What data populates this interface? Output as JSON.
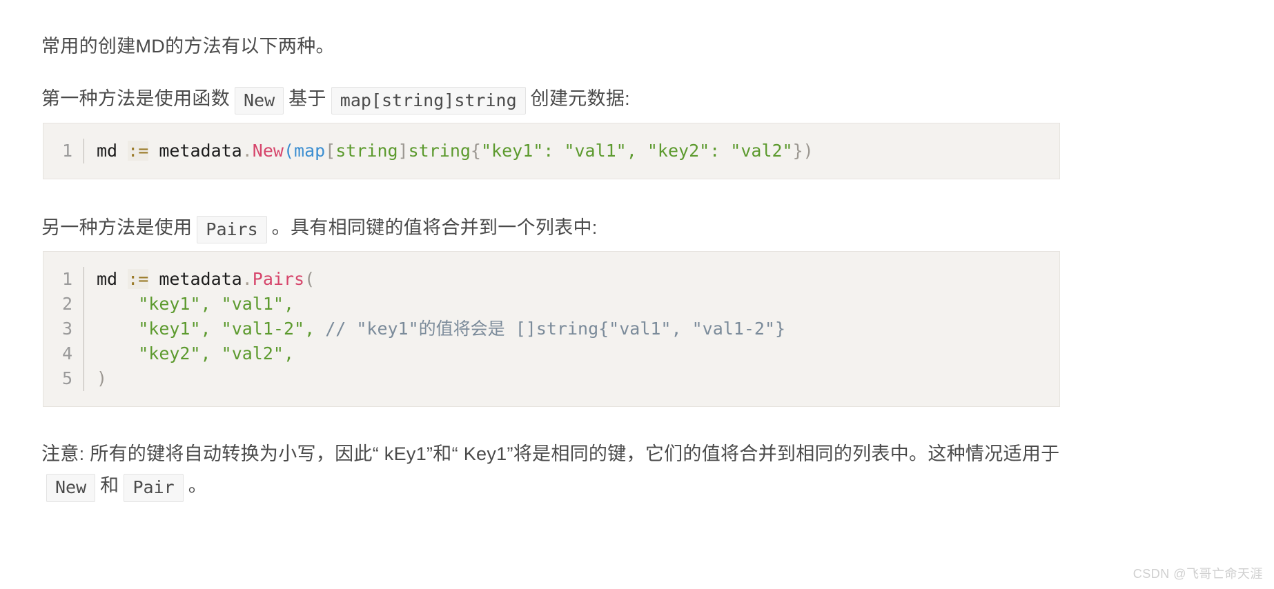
{
  "document": {
    "intro": "常用的创建MD的方法有以下两种。",
    "paragraph_first_method": {
      "part1": "第一种方法是使用函数",
      "code1": "New",
      "part2": "基于",
      "code2": "map[string]string",
      "part3": "创建元数据:"
    },
    "paragraph_second_method": {
      "part1": "另一种方法是使用",
      "code1": "Pairs",
      "part2": "。具有相同键的值将合并到一个列表中:"
    },
    "paragraph_note": {
      "part1": "注意: 所有的键将自动转换为小写，因此“ kEy1”和“ Key1”将是相同的键，它们的值将合并到相同的列表中。这种情况适用于",
      "code1": "New",
      "part2": "和",
      "code2": "Pair",
      "part3": "。"
    }
  },
  "code_block_1": {
    "language": "go",
    "lines": [
      {
        "number": "1",
        "tokens": [
          {
            "text": "md ",
            "type": "plain"
          },
          {
            "text": ":=",
            "type": "op"
          },
          {
            "text": " metadata",
            "type": "plain"
          },
          {
            "text": ".",
            "type": "dot"
          },
          {
            "text": "New",
            "type": "fn"
          },
          {
            "text": "(",
            "type": "kw"
          },
          {
            "text": "map",
            "type": "kw"
          },
          {
            "text": "[",
            "type": "punct"
          },
          {
            "text": "string",
            "type": "str"
          },
          {
            "text": "]",
            "type": "punct"
          },
          {
            "text": "string",
            "type": "str"
          },
          {
            "text": "{",
            "type": "punct"
          },
          {
            "text": "\"key1\"",
            "type": "str"
          },
          {
            "text": ":",
            "type": "str"
          },
          {
            "text": " ",
            "type": "plain"
          },
          {
            "text": "\"val1\"",
            "type": "str"
          },
          {
            "text": ",",
            "type": "str"
          },
          {
            "text": " ",
            "type": "plain"
          },
          {
            "text": "\"key2\"",
            "type": "str"
          },
          {
            "text": ":",
            "type": "str"
          },
          {
            "text": " ",
            "type": "plain"
          },
          {
            "text": "\"val2\"",
            "type": "str"
          },
          {
            "text": "}",
            "type": "punct"
          },
          {
            "text": ")",
            "type": "punct"
          }
        ]
      }
    ]
  },
  "code_block_2": {
    "language": "go",
    "lines": [
      {
        "number": "1",
        "tokens": [
          {
            "text": "md ",
            "type": "plain"
          },
          {
            "text": ":=",
            "type": "op"
          },
          {
            "text": " metadata",
            "type": "plain"
          },
          {
            "text": ".",
            "type": "dot"
          },
          {
            "text": "Pairs",
            "type": "fn"
          },
          {
            "text": "(",
            "type": "punct"
          }
        ]
      },
      {
        "number": "2",
        "tokens": [
          {
            "text": "    ",
            "type": "plain"
          },
          {
            "text": "\"key1\"",
            "type": "str"
          },
          {
            "text": ",",
            "type": "str"
          },
          {
            "text": " ",
            "type": "plain"
          },
          {
            "text": "\"val1\"",
            "type": "str"
          },
          {
            "text": ",",
            "type": "str"
          }
        ]
      },
      {
        "number": "3",
        "tokens": [
          {
            "text": "    ",
            "type": "plain"
          },
          {
            "text": "\"key1\"",
            "type": "str"
          },
          {
            "text": ",",
            "type": "str"
          },
          {
            "text": " ",
            "type": "plain"
          },
          {
            "text": "\"val1-2\"",
            "type": "str"
          },
          {
            "text": ",",
            "type": "str"
          },
          {
            "text": " ",
            "type": "plain"
          },
          {
            "text": "// \"key1\"的值将会是 []string{\"val1\", \"val1-2\"}",
            "type": "comment"
          }
        ]
      },
      {
        "number": "4",
        "tokens": [
          {
            "text": "    ",
            "type": "plain"
          },
          {
            "text": "\"key2\"",
            "type": "str"
          },
          {
            "text": ",",
            "type": "str"
          },
          {
            "text": " ",
            "type": "plain"
          },
          {
            "text": "\"val2\"",
            "type": "str"
          },
          {
            "text": ",",
            "type": "str"
          }
        ]
      },
      {
        "number": "5",
        "tokens": [
          {
            "text": ")",
            "type": "punct"
          }
        ]
      }
    ]
  },
  "watermark": {
    "text": "CSDN @飞哥亡命天涯"
  },
  "colors": {
    "page_background": "#ffffff",
    "body_text": "#4a4a4a",
    "code_background": "#f4f2ef",
    "code_border": "#e6e3de",
    "inline_code_background": "#f7f7f7",
    "inline_code_border": "#e3e3e3",
    "line_number": "#9a9a9a",
    "token_plain": "#1c1c1c",
    "token_operator": "#9a7a28",
    "token_function": "#d6456b",
    "token_keyword": "#3d8fd1",
    "token_string": "#5c9a2e",
    "token_comment": "#7b8b9a",
    "token_punct": "#9c9892",
    "watermark": "#cfcfcf"
  }
}
